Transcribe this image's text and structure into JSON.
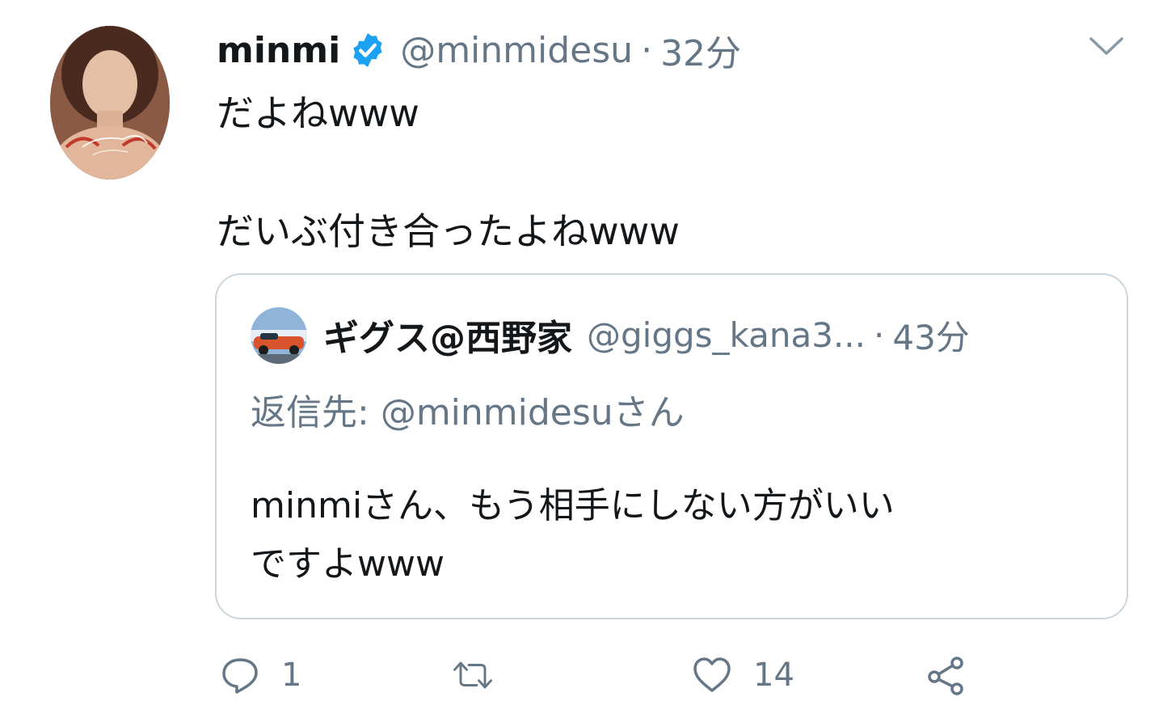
{
  "tweet": {
    "display_name": "minmi",
    "handle": "@minmidesu",
    "separator": "·",
    "time": "32分",
    "lines": [
      "だよねwww",
      "だいぶ付き合ったよねwww"
    ]
  },
  "quote": {
    "display_name": "ギグス@西野家",
    "handle": "@giggs_kana3...",
    "separator": "·",
    "time": "43分",
    "reply_label": "返信先: ",
    "reply_handle": "@minmidesuさん",
    "body_lines": [
      "minmiさん、もう相手にしない方がいい",
      "ですよwww"
    ]
  },
  "actions": {
    "reply_count": "1",
    "retweet_count": "",
    "like_count": "14"
  },
  "icons": {
    "verified": "verified-badge-icon",
    "menu": "chevron-down-icon",
    "reply": "reply-icon",
    "retweet": "retweet-icon",
    "like": "heart-icon",
    "share": "share-icon"
  },
  "colors": {
    "text_primary": "#14171a",
    "text_secondary": "#657786",
    "verified_blue": "#1da1f2",
    "border": "#ccd6dd"
  }
}
